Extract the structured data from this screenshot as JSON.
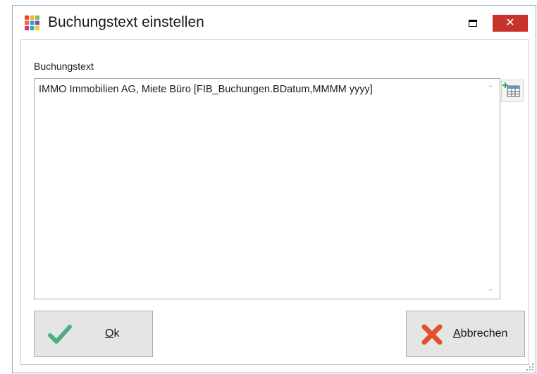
{
  "window": {
    "title": "Buchungstext einstellen",
    "icon": "app-grid-icon",
    "close_symbol": "✕"
  },
  "form": {
    "label": "Buchungstext",
    "value": "IMMO Immobilien AG, Miete Büro [FIB_Buchungen.BDatum,MMMM yyyy]",
    "scroll_up_symbol": "⌃",
    "scroll_down_symbol": "⌄",
    "insert_field_icon": "table-insert-icon"
  },
  "buttons": {
    "ok": {
      "mnemonic": "O",
      "rest": "k",
      "icon": "checkmark-icon"
    },
    "cancel": {
      "mnemonic": "A",
      "rest": "bbrechen",
      "icon": "x-icon"
    }
  },
  "colors": {
    "close_button": "#c7332b",
    "ok_check": "#4caf80",
    "cancel_x": "#e0502a"
  }
}
